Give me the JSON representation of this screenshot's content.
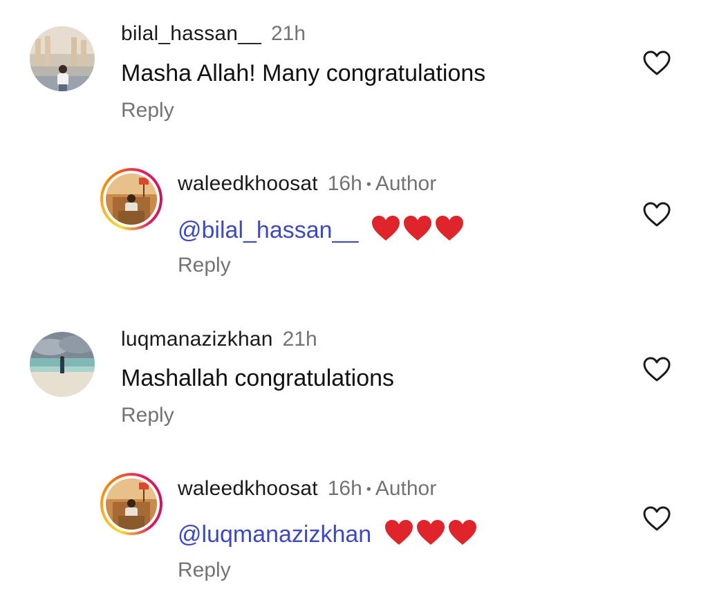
{
  "comments": [
    {
      "username": "bilal_hassan__",
      "time": "21h",
      "text": "Masha Allah! Many congratulations",
      "reply_label": "Reply"
    },
    {
      "username": "waleedkhoosat",
      "time": "16h",
      "dot": "•",
      "author_label": "Author",
      "mention": "@bilal_hassan__",
      "reply_label": "Reply"
    },
    {
      "username": "luqmanazizkhan",
      "time": "21h",
      "text": "Mashallah congratulations",
      "reply_label": "Reply"
    },
    {
      "username": "waleedkhoosat",
      "time": "16h",
      "dot": "•",
      "author_label": "Author",
      "mention": "@luqmanazizkhan",
      "reply_label": "Reply"
    }
  ],
  "icons": {
    "like": "heart-outline-icon",
    "emoji": "red-heart-emoji"
  },
  "colors": {
    "mention": "#3d49c3",
    "muted": "#737373",
    "heart_emoji": "#e0242c"
  }
}
